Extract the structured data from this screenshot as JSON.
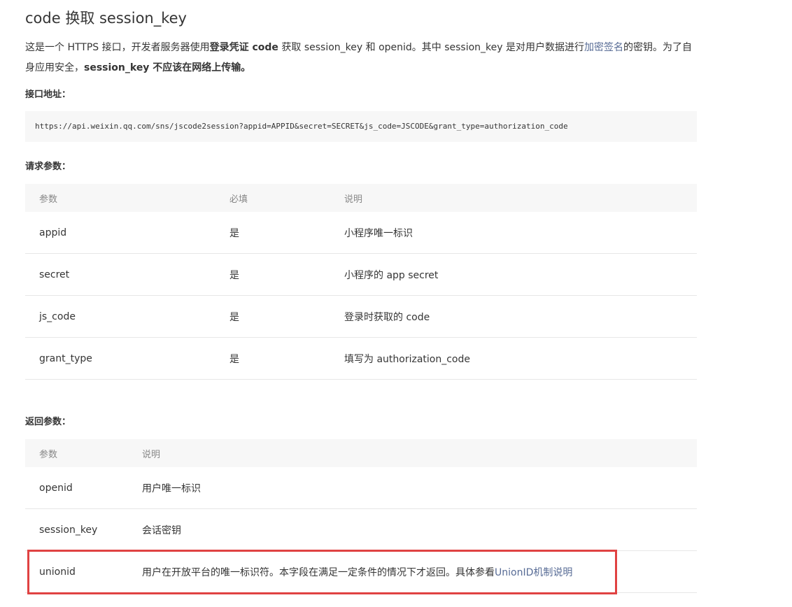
{
  "title": "code 换取 session_key",
  "intro": {
    "p1": " 这是一个 HTTPS 接口，开发者服务器使用",
    "b1": "登录凭证 code",
    "p2": " 获取 session_key 和 openid。其中 session_key 是对用户数据进行",
    "link": "加密签名",
    "p3": "的密钥。为了自身应用安全，",
    "b2": "session_key 不应该在网络上传输。"
  },
  "endpoint": {
    "label": "接口地址：",
    "url": "https://api.weixin.qq.com/sns/jscode2session?appid=APPID&secret=SECRET&js_code=JSCODE&grant_type=authorization_code"
  },
  "request": {
    "label": "请求参数：",
    "headers": [
      "参数",
      "必填",
      "说明"
    ],
    "rows": [
      {
        "param": "appid",
        "required": "是",
        "desc": "小程序唯一标识"
      },
      {
        "param": "secret",
        "required": "是",
        "desc": "小程序的 app secret"
      },
      {
        "param": "js_code",
        "required": "是",
        "desc": "登录时获取的 code"
      },
      {
        "param": "grant_type",
        "required": "是",
        "desc": "填写为 authorization_code"
      }
    ]
  },
  "response": {
    "label": "返回参数：",
    "headers": [
      "参数",
      "说明"
    ],
    "rows": [
      {
        "param": "openid",
        "desc": "用户唯一标识"
      },
      {
        "param": "session_key",
        "desc": "会话密钥"
      },
      {
        "param": "unionid",
        "desc": "用户在开放平台的唯一标识符。本字段在满足一定条件的情况下才返回。具体参看",
        "link": "UnionID机制说明"
      }
    ]
  },
  "colors": {
    "link": "#576b95",
    "highlight": "#e04242",
    "header_bg": "#f7f7f7"
  }
}
